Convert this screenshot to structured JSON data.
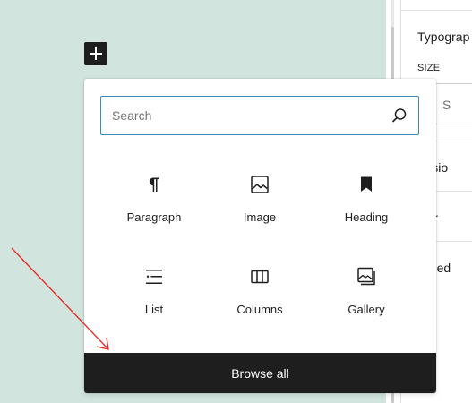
{
  "sidebar": {
    "typography_title": "Typograp",
    "size_label": "SIZE",
    "size_value": "S",
    "rows": {
      "dimensions": "mensio",
      "border": "rder",
      "advanced": "vanced"
    }
  },
  "inserter": {
    "search": {
      "placeholder": "Search",
      "value": ""
    },
    "blocks": {
      "paragraph": "Paragraph",
      "image": "Image",
      "heading": "Heading",
      "list": "List",
      "columns": "Columns",
      "gallery": "Gallery"
    },
    "browse_all": "Browse all"
  },
  "icons": {
    "plus": "plus-icon",
    "search": "search-icon",
    "paragraph": "paragraph-icon",
    "image": "image-icon",
    "heading": "bookmark-icon",
    "list": "list-icon",
    "columns": "columns-icon",
    "gallery": "gallery-icon"
  },
  "colors": {
    "canvas_background": "#d2e4de",
    "focus_border": "#3d8bb0",
    "dark": "#1e1e1e",
    "annotation_arrow": "#e8251e"
  }
}
